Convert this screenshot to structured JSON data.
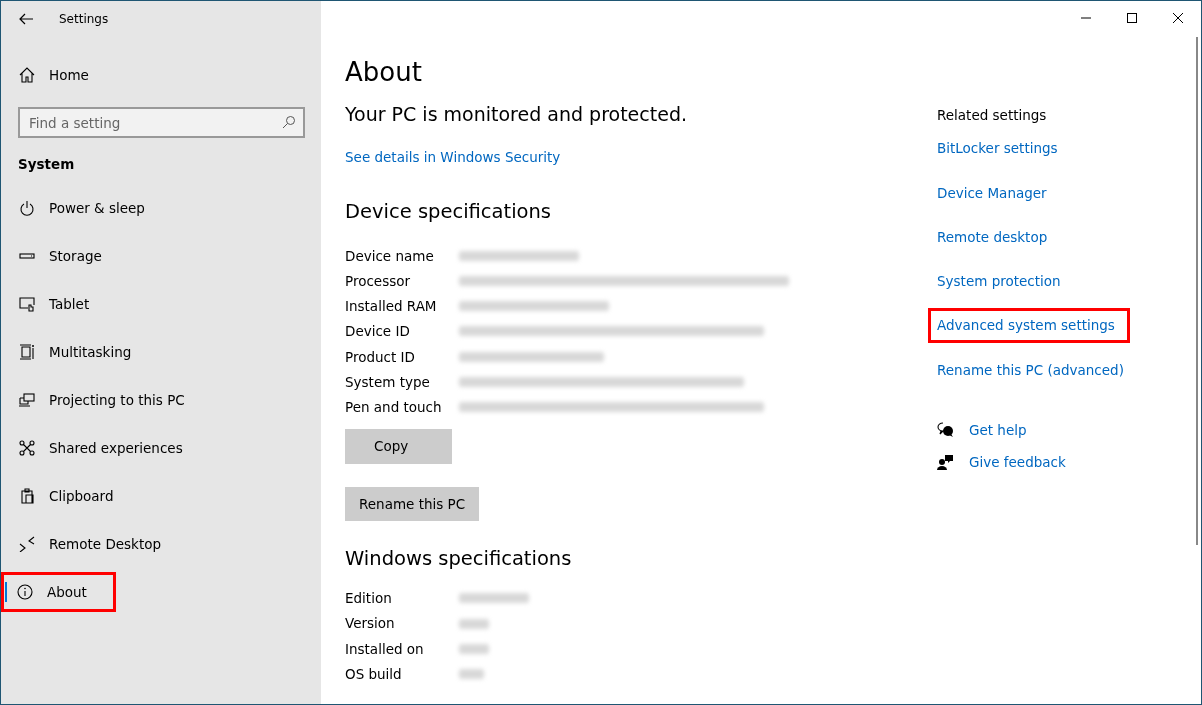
{
  "window": {
    "title": "Settings"
  },
  "sidebar": {
    "home": "Home",
    "search": {
      "placeholder": "Find a setting"
    },
    "section": "System",
    "items": [
      {
        "label": "Power & sleep",
        "selected": false,
        "highlighted": false
      },
      {
        "label": "Storage",
        "selected": false,
        "highlighted": false
      },
      {
        "label": "Tablet",
        "selected": false,
        "highlighted": false
      },
      {
        "label": "Multitasking",
        "selected": false,
        "highlighted": false
      },
      {
        "label": "Projecting to this PC",
        "selected": false,
        "highlighted": false
      },
      {
        "label": "Shared experiences",
        "selected": false,
        "highlighted": false
      },
      {
        "label": "Clipboard",
        "selected": false,
        "highlighted": false
      },
      {
        "label": "Remote Desktop",
        "selected": false,
        "highlighted": false
      },
      {
        "label": "About",
        "selected": true,
        "highlighted": true
      }
    ]
  },
  "main": {
    "title": "About",
    "protection": "Your PC is monitored and protected.",
    "security_link": "See details in Windows Security",
    "device_heading": "Device specifications",
    "device_specs": [
      {
        "label": "Device name",
        "redacted": true
      },
      {
        "label": "Processor",
        "redacted": true
      },
      {
        "label": "Installed RAM",
        "redacted": true
      },
      {
        "label": "Device ID",
        "redacted": true
      },
      {
        "label": "Product ID",
        "redacted": true
      },
      {
        "label": "System type",
        "redacted": true
      },
      {
        "label": "Pen and touch",
        "redacted": true
      }
    ],
    "copy_button": "Copy",
    "rename_button": "Rename this PC",
    "windows_heading": "Windows specifications",
    "windows_specs": [
      {
        "label": "Edition",
        "redacted": true
      },
      {
        "label": "Version",
        "redacted": true
      },
      {
        "label": "Installed on",
        "redacted": true
      },
      {
        "label": "OS build",
        "redacted": true
      }
    ]
  },
  "related": {
    "heading": "Related settings",
    "links": [
      {
        "label": "BitLocker settings",
        "highlighted": false
      },
      {
        "label": "Device Manager",
        "highlighted": false
      },
      {
        "label": "Remote desktop",
        "highlighted": false
      },
      {
        "label": "System protection",
        "highlighted": false
      },
      {
        "label": "Advanced system settings",
        "highlighted": true
      },
      {
        "label": "Rename this PC (advanced)",
        "highlighted": false
      }
    ],
    "help": [
      {
        "label": "Get help"
      },
      {
        "label": "Give feedback"
      }
    ]
  }
}
